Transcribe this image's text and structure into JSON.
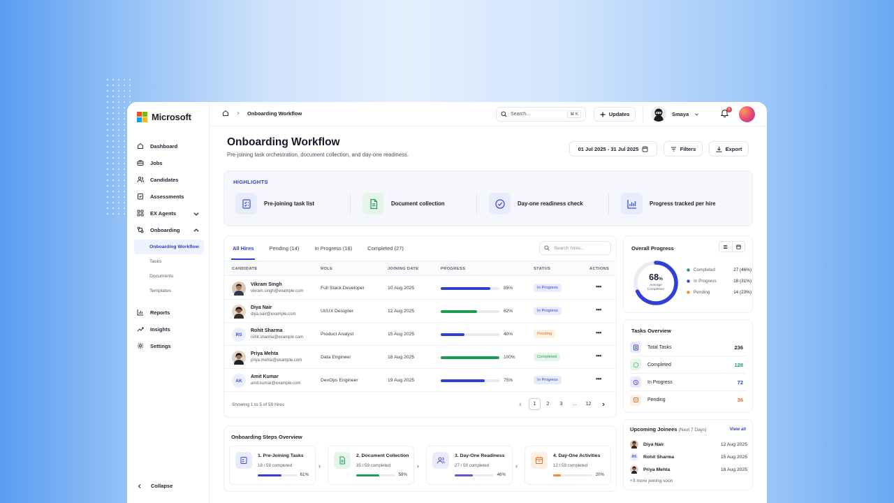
{
  "brand": {
    "name": "Microsoft"
  },
  "sidebar": {
    "items": [
      {
        "label": "Dashboard"
      },
      {
        "label": "Jobs"
      },
      {
        "label": "Candidates"
      },
      {
        "label": "Assessments"
      },
      {
        "label": "EX Agents"
      },
      {
        "label": "Onboarding"
      }
    ],
    "subitems": [
      {
        "label": "Onboarding Workflow"
      },
      {
        "label": "Tasks"
      },
      {
        "label": "Documents"
      },
      {
        "label": "Templates"
      }
    ],
    "items2": [
      {
        "label": "Reports"
      },
      {
        "label": "Insights"
      },
      {
        "label": "Settings"
      }
    ],
    "collapse": "Collapse"
  },
  "topbar": {
    "breadcrumb": "Onboarding Workflow",
    "search_placeholder": "Search...",
    "search_shortcut": "⌘ K",
    "updates": "Updates",
    "user": "Smaya",
    "notif_count": "6"
  },
  "page": {
    "title": "Onboarding Workflow",
    "subtitle": "Pre-joining task orchestration, document collection, and day-one readiness.",
    "date_range": "01 Jul 2025 - 31 Jul 2025",
    "filters": "Filters",
    "export": "Export"
  },
  "highlights": {
    "title": "HIGHLIGHTS",
    "items": [
      {
        "label": "Pre-joining task list",
        "icon": "checklist-icon",
        "color": "#3b4fd1"
      },
      {
        "label": "Document collection",
        "icon": "document-icon",
        "color": "#1f9d55"
      },
      {
        "label": "Day-one readiness check",
        "icon": "check-circle-icon",
        "color": "#3b4fd1"
      },
      {
        "label": "Progress tracked per hire",
        "icon": "bar-chart-icon",
        "color": "#3b4fd1"
      }
    ]
  },
  "hires": {
    "tabs": [
      "All Hires",
      "Pending (14)",
      "In Progress (18)",
      "Completed (27)"
    ],
    "search_placeholder": "Search hires...",
    "columns": [
      "CANDIDATE",
      "ROLE",
      "JOINING DATE",
      "PROGRESS",
      "STATUS",
      "ACTIONS"
    ],
    "rows": [
      {
        "name": "Vikram Singh",
        "email": "vikram.singh@example.com",
        "role": "Full Stack Developer",
        "date": "10 Aug 2025",
        "progress": 85,
        "progress_label": "85%",
        "status": "In Progress",
        "initials": ""
      },
      {
        "name": "Diya Nair",
        "email": "diya.nair@example.com",
        "role": "UI/UX Designer",
        "date": "12 Aug 2025",
        "progress": 62,
        "progress_label": "62%",
        "status": "In Progress",
        "initials": ""
      },
      {
        "name": "Rohit Sharma",
        "email": "rohit.sharma@example.com",
        "role": "Product Analyst",
        "date": "15 Aug 2025",
        "progress": 40,
        "progress_label": "40%",
        "status": "Pending",
        "initials": "RS"
      },
      {
        "name": "Priya Mehta",
        "email": "priya.mehta@example.com",
        "role": "Data Engineer",
        "date": "18 Aug 2025",
        "progress": 100,
        "progress_label": "100%",
        "status": "Completed",
        "initials": ""
      },
      {
        "name": "Amit Kumar",
        "email": "amit.kumar@example.com",
        "role": "DevOps Engineer",
        "date": "19 Aug 2025",
        "progress": 75,
        "progress_label": "75%",
        "status": "In Progress",
        "initials": "AK"
      }
    ],
    "footer": "Showing 1 to 5 of 59 hires",
    "pages": [
      "1",
      "2",
      "3",
      "...",
      "12"
    ]
  },
  "overall": {
    "title": "Overall Progress",
    "percent": "68",
    "percent_sign": "%",
    "caption": "Average Completion",
    "legend": [
      {
        "label": "Completed",
        "value": "27 (46%)",
        "color": "#1f9d55"
      },
      {
        "label": "In Progress",
        "value": "18 (31%)",
        "color": "#2f3fd8"
      },
      {
        "label": "Pending",
        "value": "14 (23%)",
        "color": "#f08a24"
      }
    ]
  },
  "tasks": {
    "title": "Tasks Overview",
    "items": [
      {
        "label": "Total Tasks",
        "value": "236",
        "color": "#1a1d2b"
      },
      {
        "label": "Completed",
        "value": "128",
        "color": "#1f9d55"
      },
      {
        "label": "In Progress",
        "value": "72",
        "color": "#2f3fd8"
      },
      {
        "label": "Pending",
        "value": "36",
        "color": "#e8672a"
      }
    ]
  },
  "joinees": {
    "title": "Upcoming Joinees",
    "subtitle": "(Next 7 Days)",
    "view_all": "View all",
    "items": [
      {
        "name": "Diya Nair",
        "date": "12 Aug 2025",
        "initials": ""
      },
      {
        "name": "Rohit Sharma",
        "date": "15 Aug 2025",
        "initials": "RS"
      },
      {
        "name": "Priya Mehta",
        "date": "18 Aug 2025",
        "initials": ""
      }
    ],
    "more": "+3 more joining soon"
  },
  "steps": {
    "title": "Onboarding Steps Overview",
    "items": [
      {
        "title": "1. Pre-Joining Tasks",
        "sub": "18 / 59 completed",
        "pct": "61%",
        "value": 61,
        "color": "#2f3fd8"
      },
      {
        "title": "2. Document Collection",
        "sub": "35 / 59 completed",
        "pct": "59%",
        "value": 59,
        "color": "#1f9d55"
      },
      {
        "title": "3. Day-One Readiness",
        "sub": "27 / 59 completed",
        "pct": "46%",
        "value": 46,
        "color": "#6a4fd8"
      },
      {
        "title": "4. Day-One Activities",
        "sub": "12 / 59 completed",
        "pct": "20%",
        "value": 20,
        "color": "#f08a24"
      }
    ]
  }
}
